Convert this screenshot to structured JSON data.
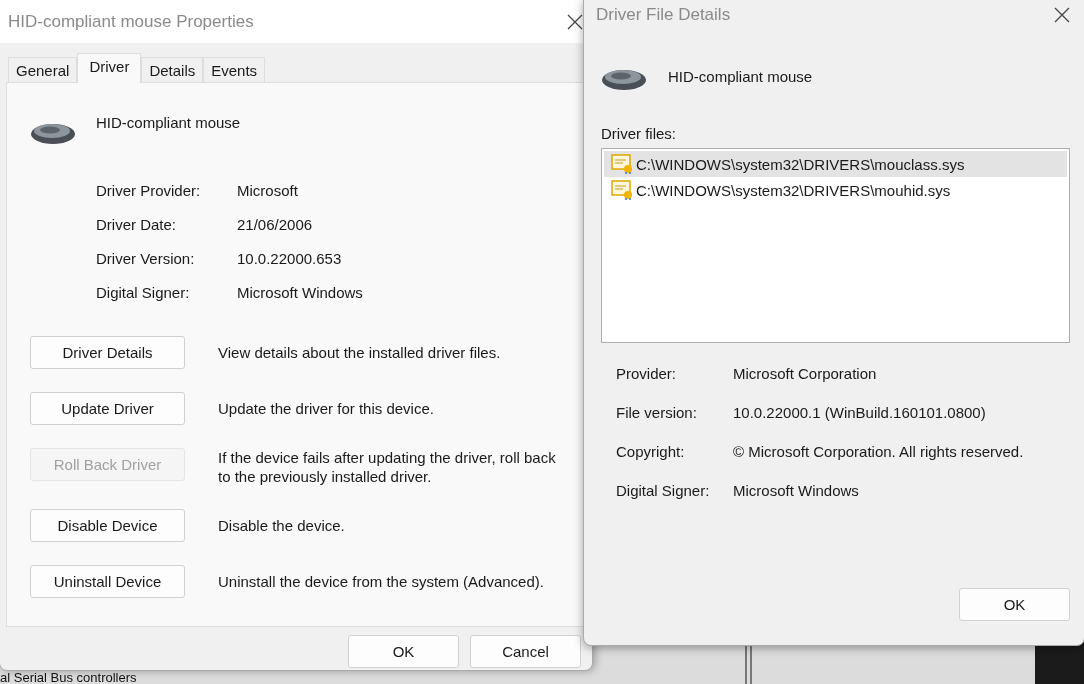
{
  "background": {
    "tree_item": "al Serial Bus controllers"
  },
  "properties_window": {
    "title": "HID-compliant mouse Properties",
    "tabs": [
      {
        "label": "General",
        "selected": false
      },
      {
        "label": "Driver",
        "selected": true
      },
      {
        "label": "Details",
        "selected": false
      },
      {
        "label": "Events",
        "selected": false
      }
    ],
    "device_name": "HID-compliant mouse",
    "info": [
      {
        "label": "Driver Provider:",
        "value": "Microsoft"
      },
      {
        "label": "Driver Date:",
        "value": "21/06/2006"
      },
      {
        "label": "Driver Version:",
        "value": "10.0.22000.653"
      },
      {
        "label": "Digital Signer:",
        "value": "Microsoft Windows"
      }
    ],
    "actions": [
      {
        "button": "Driver Details",
        "description": "View details about the installed driver files.",
        "disabled": false
      },
      {
        "button": "Update Driver",
        "description": "Update the driver for this device.",
        "disabled": false
      },
      {
        "button": "Roll Back Driver",
        "description": "If the device fails after updating the driver, roll back to the previously installed driver.",
        "disabled": true
      },
      {
        "button": "Disable Device",
        "description": "Disable the device.",
        "disabled": false
      },
      {
        "button": "Uninstall Device",
        "description": "Uninstall the device from the system (Advanced).",
        "disabled": false
      }
    ],
    "buttons": [
      "OK",
      "Cancel"
    ]
  },
  "file_details_window": {
    "title": "Driver File Details",
    "device_name": "HID-compliant mouse",
    "files_label": "Driver files:",
    "files": [
      {
        "path": "C:\\WINDOWS\\system32\\DRIVERS\\mouclass.sys",
        "selected": true
      },
      {
        "path": "C:\\WINDOWS\\system32\\DRIVERS\\mouhid.sys",
        "selected": false
      }
    ],
    "info": [
      {
        "label": "Provider:",
        "value": "Microsoft Corporation"
      },
      {
        "label": "File version:",
        "value": "10.0.22000.1 (WinBuild.160101.0800)"
      },
      {
        "label": "Copyright:",
        "value": "© Microsoft Corporation. All rights reserved."
      },
      {
        "label": "Digital Signer:",
        "value": "Microsoft Windows"
      }
    ],
    "button": "OK"
  }
}
